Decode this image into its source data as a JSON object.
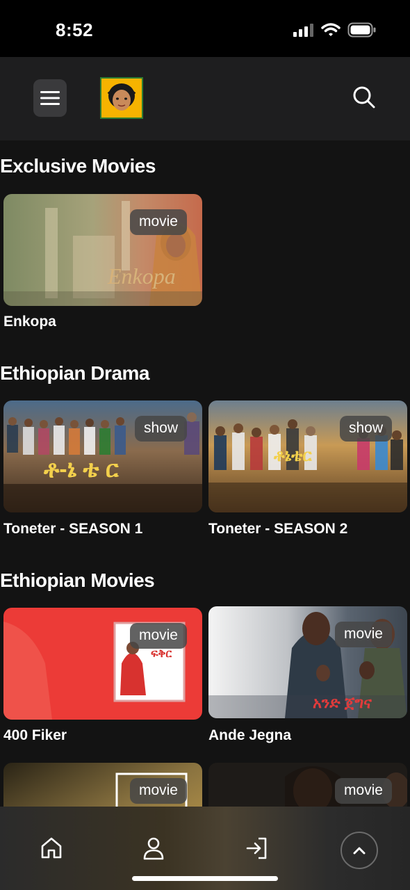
{
  "status_bar": {
    "time": "8:52"
  },
  "sections": [
    {
      "title": "Exclusive Movies",
      "items": [
        {
          "title": "Enkopa",
          "badge": "movie",
          "poster_text": "Enkopa"
        }
      ]
    },
    {
      "title": "Ethiopian Drama",
      "items": [
        {
          "title": "Toneter - SEASON 1",
          "badge": "show",
          "poster_text": "ቶ-ኔ ቴ ር"
        },
        {
          "title": "Toneter - SEASON 2",
          "badge": "show",
          "poster_text": "ቶኔቴር"
        }
      ]
    },
    {
      "title": "Ethiopian Movies",
      "items": [
        {
          "title": "400 Fiker",
          "badge": "movie",
          "poster_text": "ፍቅር"
        },
        {
          "title": "Ande Jegna",
          "badge": "movie",
          "poster_text": "አንድ ጀግና"
        },
        {
          "title": "",
          "badge": "movie"
        },
        {
          "title": "",
          "badge": "movie"
        }
      ]
    }
  ],
  "nav": {
    "items": [
      "home-icon",
      "user-icon",
      "login-icon"
    ],
    "scroll_top_icon": "chevron-up-icon"
  },
  "colors": {
    "background": "#131313",
    "header": "#1e1e1f",
    "badge": "#464646",
    "accent_red": "#e53935"
  }
}
